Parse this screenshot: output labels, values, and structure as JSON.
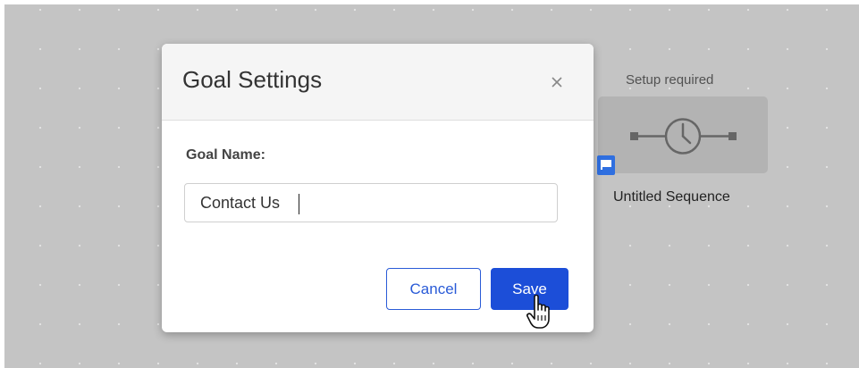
{
  "canvas": {
    "node": {
      "status": "Setup required",
      "title": "Untitled Sequence",
      "icon": "clock-icon"
    }
  },
  "modal": {
    "title": "Goal Settings",
    "close_glyph": "×",
    "field_label": "Goal Name:",
    "goal_name_value": "Contact Us",
    "cancel_label": "Cancel",
    "save_label": "Save"
  },
  "colors": {
    "canvas_bg": "#c4c4c4",
    "primary": "#1c4ed8",
    "flag": "#2f6fe0"
  }
}
